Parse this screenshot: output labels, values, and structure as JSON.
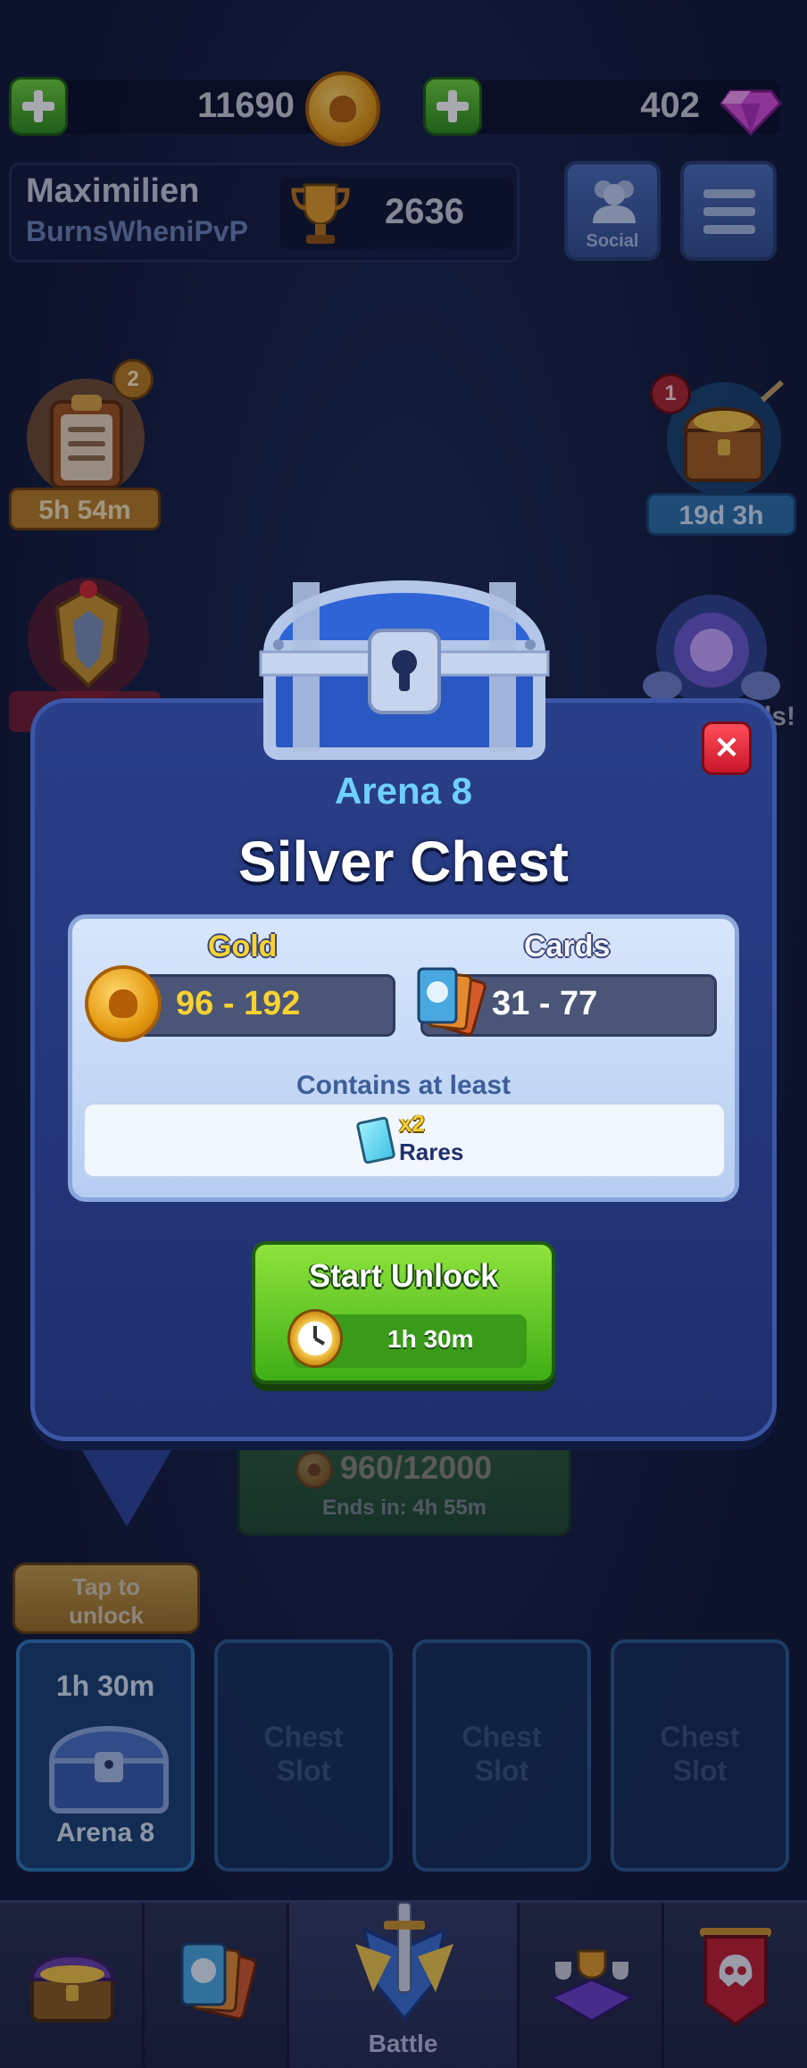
{
  "currency": {
    "gold": "11690",
    "gems": "402"
  },
  "profile": {
    "name": "Maximilien",
    "tag": "BurnsWheniPvP",
    "trophies": "2636"
  },
  "top_buttons": {
    "social_label": "Social"
  },
  "side_left": {
    "quests_badge": "2",
    "quests_timer": "5h 54m"
  },
  "side_right": {
    "treasure_badge": "1",
    "treasure_timer": "19d 3h",
    "partial_text": "ls!"
  },
  "modal": {
    "arena": "Arena 8",
    "title": "Silver Chest",
    "gold_label": "Gold",
    "gold_range": "96 - 192",
    "cards_label": "Cards",
    "cards_range": "31 - 77",
    "contains_label": "Contains at least",
    "rare_count": "x2",
    "rare_label": "Rares",
    "unlock_label": "Start Unlock",
    "unlock_time": "1h 30m"
  },
  "event": {
    "progress": "960/12000",
    "ends": "Ends in: 4h 55m"
  },
  "slots": {
    "tap_hint_line1": "Tap to",
    "tap_hint_line2": "unlock",
    "slot1_time": "1h 30m",
    "slot1_arena": "Arena 8",
    "empty_line1": "Chest",
    "empty_line2": "Slot"
  },
  "nav": {
    "battle_label": "Battle"
  },
  "colors": {
    "accent_green": "#5fcf2a",
    "accent_blue": "#2a3f8a",
    "gold_text": "#f7d231",
    "arena_cyan": "#6fd0ff",
    "close_red": "#e8273a"
  }
}
